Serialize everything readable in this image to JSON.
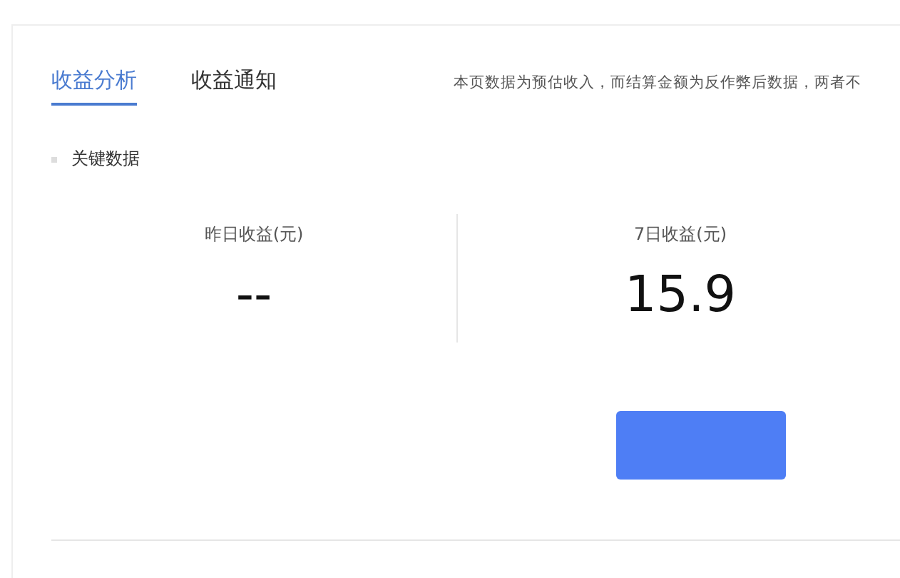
{
  "tabs": [
    {
      "label": "收益分析",
      "selected": true
    },
    {
      "label": "收益通知",
      "selected": false
    }
  ],
  "notice": "本页数据为预估收入，而结算金额为反作弊后数据，两者不",
  "section_title": "关键数据",
  "stats": [
    {
      "label": "昨日收益(元)",
      "value": "--"
    },
    {
      "label": "7日收益(元)",
      "value": "15.9"
    }
  ],
  "action_button": {
    "kind": "primary"
  }
}
